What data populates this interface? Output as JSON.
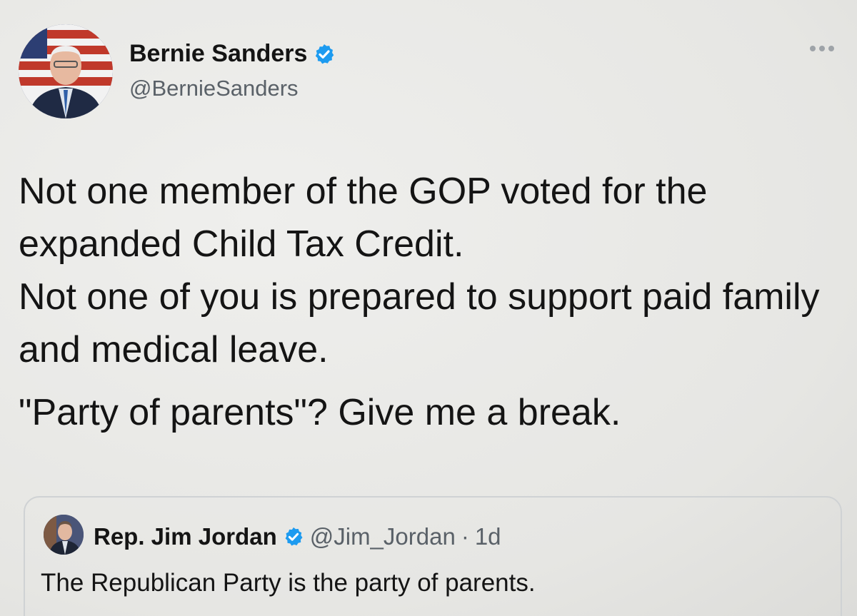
{
  "tweet": {
    "author": {
      "display_name": "Bernie Sanders",
      "handle": "@BernieSanders",
      "verified": true
    },
    "more_icon": "more-horizontal-icon",
    "text_lines": [
      "Not one member of the GOP voted for the expanded Child Tax Credit.",
      "Not one of you is prepared to support paid family and medical leave.",
      "\"Party of parents\"? Give me a break."
    ]
  },
  "quoted_tweet": {
    "display_name": "Rep. Jim Jordan",
    "handle": "@Jim_Jordan",
    "separator": "·",
    "time": "1d",
    "verified": true,
    "text": "The Republican Party is the party of parents."
  },
  "colors": {
    "verified_blue": "#1d9bf0",
    "text": "#141414",
    "secondary_text": "#5a6168"
  }
}
